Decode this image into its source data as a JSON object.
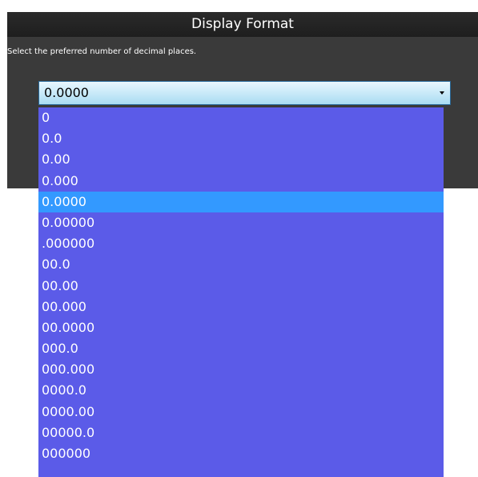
{
  "dialog": {
    "title": "Display Format",
    "instruction": "Select the preferred number of decimal places."
  },
  "select": {
    "value": "0.0000",
    "options": [
      "0",
      "0.0",
      "0.00",
      "0.000",
      "0.0000",
      "0.00000",
      ".000000",
      "00.0",
      "00.00",
      "00.000",
      "00.0000",
      "000.0",
      "000.000",
      "0000.0",
      "0000.00",
      "00000.0",
      "000000"
    ],
    "selected_index": 4
  },
  "colors": {
    "dialog_bg": "#3a3a3a",
    "title_bg": "#222222",
    "list_bg": "#5b5be8",
    "highlight": "#3399ff"
  },
  "icons": {
    "dropdown_arrow": "chevron-down-icon"
  }
}
